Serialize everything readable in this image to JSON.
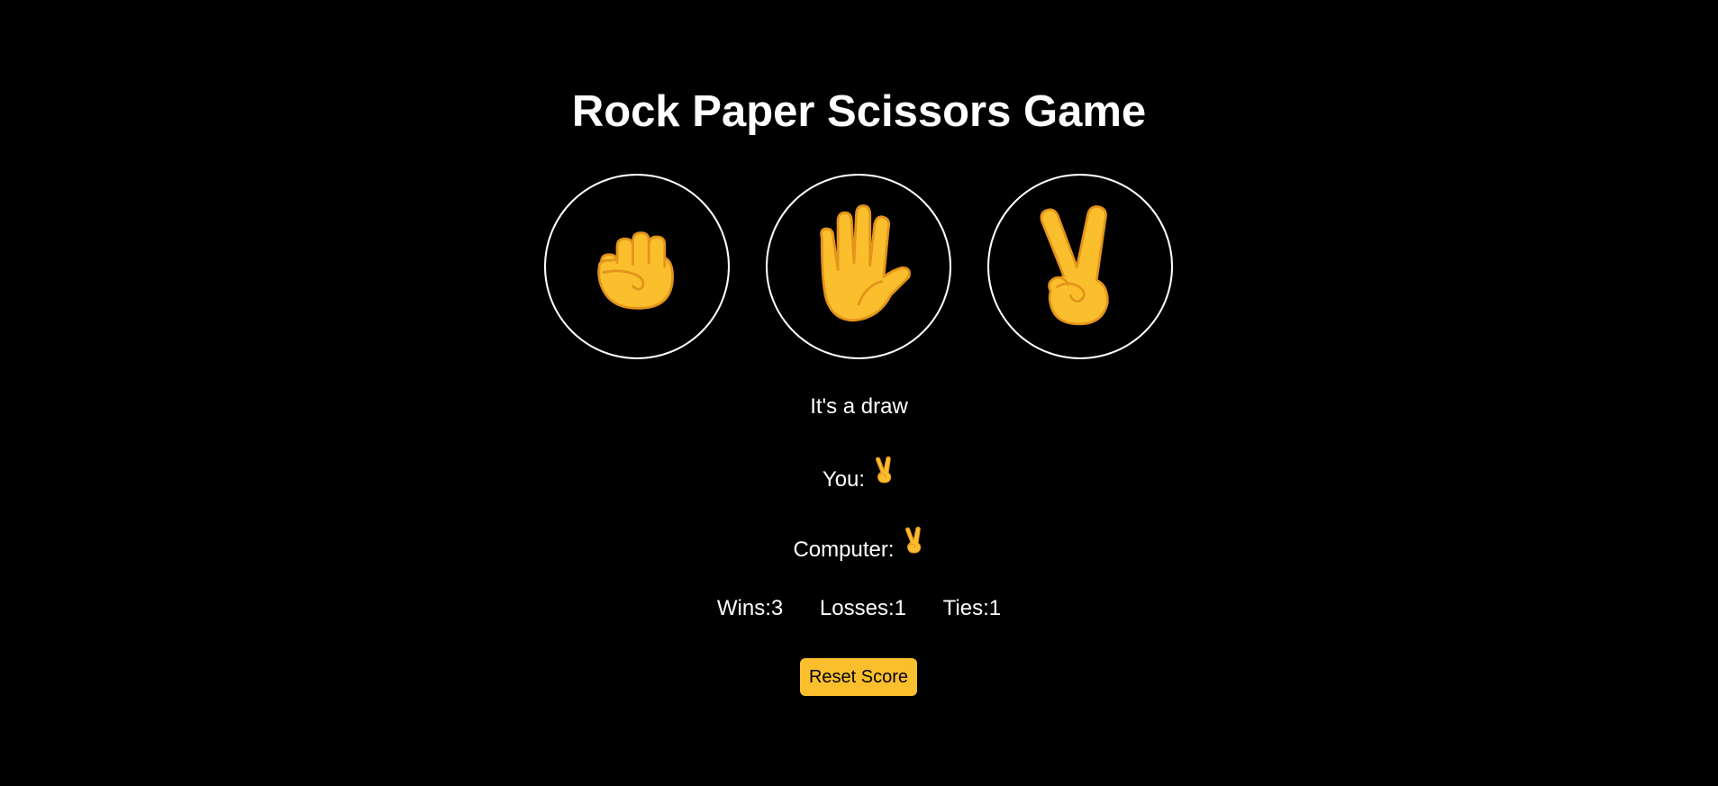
{
  "header": {
    "title": "Rock Paper Scissors Game"
  },
  "choices": [
    {
      "name": "rock",
      "icon": "raised-fist-icon"
    },
    {
      "name": "paper",
      "icon": "raised-hand-icon"
    },
    {
      "name": "scissors",
      "icon": "victory-hand-icon"
    }
  ],
  "result": {
    "message": "It's a draw",
    "you_label": "You:",
    "you_choice_icon": "victory-hand-icon",
    "computer_label": "Computer:",
    "computer_choice_icon": "victory-hand-icon"
  },
  "score": {
    "wins": "Wins:3",
    "losses": "Losses:1",
    "ties": "Ties:1"
  },
  "controls": {
    "reset_label": "Reset Score"
  },
  "colors": {
    "background": "#000000",
    "text": "#ffffff",
    "accent": "#fbbf2e",
    "emoji_skin": "#fbbf2e",
    "emoji_line": "#e3941a"
  }
}
